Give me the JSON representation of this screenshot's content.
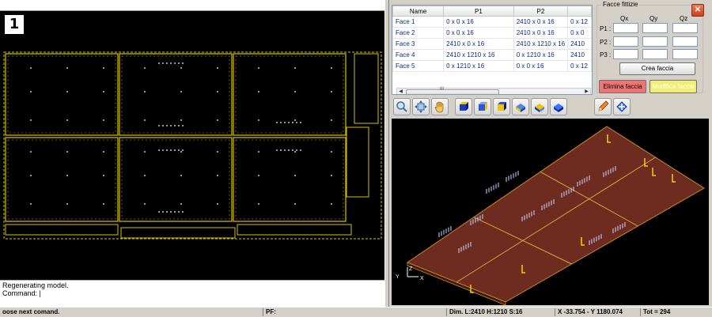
{
  "viewport": {
    "number_label": "1"
  },
  "command": {
    "line1": " Regenerating model.",
    "line2": "Command:  |"
  },
  "faces_table": {
    "columns": [
      "Name",
      "P1",
      "P2",
      ""
    ],
    "rows": [
      {
        "name": "Face 1",
        "p1": "0 x 0 x 16",
        "p2": "2410 x 0 x 16",
        "p3": "0 x 12"
      },
      {
        "name": "Face 2",
        "p1": "0 x 0 x 16",
        "p2": "2410 x 0 x 16",
        "p3": "0 x 0"
      },
      {
        "name": "Face 3",
        "p1": "2410 x 0 x 16",
        "p2": "2410 x 1210 x 16",
        "p3": "2410"
      },
      {
        "name": "Face 4",
        "p1": "2410 x 1210 x 16",
        "p2": "0 x 1210 x 16",
        "p3": "2410"
      },
      {
        "name": "Face 5",
        "p1": "0 x 1210 x 16",
        "p2": "0 x 0 x 16",
        "p3": "0 x 12"
      }
    ],
    "scroll_grip": "III"
  },
  "fittizie": {
    "title": "Facce fittizie",
    "col_qx": "Qx",
    "col_qy": "Qy",
    "col_qz": "Qz",
    "row_p1": "P1 :",
    "row_p2": "P2 :",
    "row_p3": "P3 :",
    "crea_label": "Crea faccia",
    "elimina_label": "Elimina faccia",
    "modifica_label": "Modifica faccia",
    "close_glyph": "✕"
  },
  "toolbar": {
    "icons": [
      "zoom-icon",
      "fit-view-icon",
      "pan-hand-icon",
      "view-front-icon",
      "view-back-icon",
      "view-top-icon",
      "view-iso-left-icon",
      "view-iso-right-icon",
      "view-bottom-icon",
      "pencil-edit-icon",
      "rotate-3d-icon"
    ]
  },
  "axes3d": {
    "y_label": "Y",
    "z_label": "Z",
    "x_label": "X"
  },
  "statusbar": {
    "prompt": "oose next comand.",
    "pf": "PF:",
    "dim": "Dim. L:2410 H:1210 S:16",
    "coords": "X -33.754 - Y 1180.074",
    "tot": "Tot = 294"
  },
  "colors": {
    "panel_bg": "#d4d0c8",
    "cad_yellow": "#d8c200",
    "board_fill": "#6e2c20",
    "delete_red": "#f07474",
    "modify_yellow": "#f1ef72"
  }
}
